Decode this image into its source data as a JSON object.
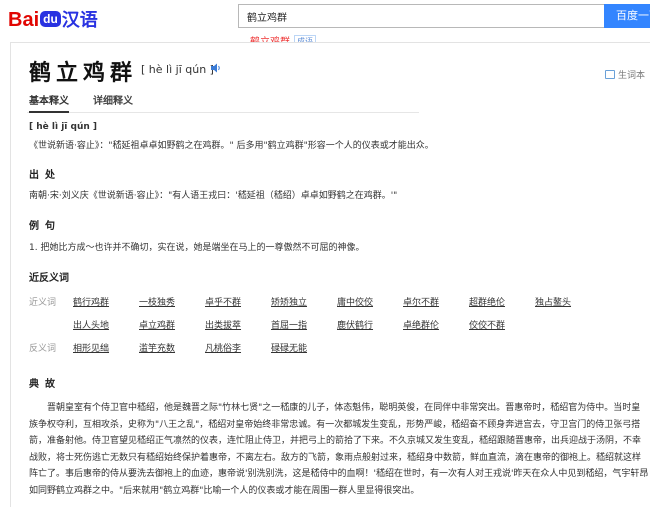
{
  "logo": {
    "bai": "Bai",
    "du": "du",
    "hanyu": "汉语"
  },
  "search": {
    "query": "鹤立鸡群",
    "button_label": "百度一下"
  },
  "suggestion": {
    "word": "鹤立鸡群",
    "tag": "成语"
  },
  "entry": {
    "word": "鹤立鸡群",
    "pinyin": "[ hè lì jī qún ]",
    "vocab_label": "生词本"
  },
  "tabs": [
    {
      "label": "基本释义"
    },
    {
      "label": "详细释义"
    }
  ],
  "basic": {
    "pinyin": "[ hè lì jī qún ]",
    "text": "《世说新语·容止》：\"嵇延祖卓卓如野鹤之在鸡群。\" 后多用\"鹤立鸡群\"形容一个人的仪表或才能出众。"
  },
  "source": {
    "title": "出处",
    "text": "南朝·宋·刘义庆《世说新语·容止》：\"有人语王戎曰：'嵇延祖（嵇绍）卓卓如野鹤之在鸡群。'\""
  },
  "example": {
    "title": "例句",
    "text": "1. 把她比方成～也许并不确切，实在说，她是端坐在马上的一尊傲然不可屈的神像。"
  },
  "relations": {
    "title": "近反义词",
    "synonym_label": "近义词",
    "antonym_label": "反义词",
    "synonyms": [
      "鹤行鸡群",
      "一枝独秀",
      "卓乎不群",
      "矫矫独立",
      "庸中佼佼",
      "卓尔不群",
      "超群绝伦",
      "独占鳌头",
      "出人头地",
      "卓立鸡群",
      "出类拔萃",
      "首屈一指",
      "鹿伏鹤行",
      "卓绝群伦",
      "佼佼不群"
    ],
    "antonyms": [
      "相形见绌",
      "滥竽充数",
      "凡桃俗李",
      "碌碌无能"
    ]
  },
  "meaning": {
    "title": "典故",
    "text": "晋朝皇室有个侍卫官中嵇绍，他是魏晋之际\"竹林七贤\"之一嵇康的儿子，体态魁伟，聪明英俊，在同伴中非常突出。晋惠帝时，嵇绍官为侍中。当时皇族争权夺利，互相攻杀，史称为\"八王之乱\"，嵇绍对皇帝始终非常忠诚。有一次都城发生变乱，形势严峻，嵇绍奋不顾身奔进宫去，守卫宫门的侍卫张弓搭箭，准备射他。侍卫官望见嵇绍正气凛然的仪表，连忙阻止侍卫，并把弓上的箭拾了下来。不久京城又发生变乱，嵇绍跟随晋惠帝，出兵迎战于汤阴，不幸战败，将士死伤逃亡无数只有嵇绍始终保护着惠帝，不离左右。敌方的飞箭，象雨点般射过来，嵇绍身中数箭，鲜血直流，滴在惠帝的御袍上。嵇绍就这样阵亡了。事后惠帝的侍从要洗去御袍上的血迹，惠帝说'别洗别洗，这是嵇侍中的血啊！'嵇绍在世时，有一次有人对王戎说'昨天在众人中见到嵇绍，气宇轩昂如同野鹤立鸡群之中。\"后来就用\"鹤立鸡群\"比喻一个人的仪表或才能在周围一群人里显得很突出。"
  }
}
